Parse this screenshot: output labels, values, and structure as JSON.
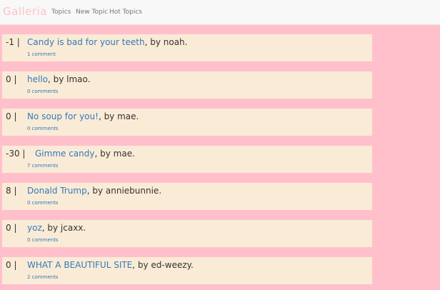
{
  "navbar": {
    "brand": "Galleria",
    "links": [
      "Topics",
      "New Topic",
      "Hot Topics"
    ]
  },
  "topics": [
    {
      "votes": "-1 |",
      "title": "Candy is bad for your teeth",
      "byline": ", by noah.",
      "comments": "1 comment"
    },
    {
      "votes": "0 |",
      "title": "hello",
      "byline": ", by lmao.",
      "comments": "0 comments"
    },
    {
      "votes": "0 |",
      "title": "No soup for you!",
      "byline": ", by mae.",
      "comments": "0 comments"
    },
    {
      "votes": "-30 |",
      "title": "Gimme candy",
      "byline": ", by mae.",
      "comments": "7 comments"
    },
    {
      "votes": "8 |",
      "title": "Donald Trump",
      "byline": ", by anniebunnie.",
      "comments": "0 comments"
    },
    {
      "votes": "0 |",
      "title": "yoz",
      "byline": ", by jcaxx.",
      "comments": "0 comments"
    },
    {
      "votes": "0 |",
      "title": "WHAT A BEAUTIFUL SITE",
      "byline": ", by ed-weezy.",
      "comments": "2 comments"
    }
  ]
}
